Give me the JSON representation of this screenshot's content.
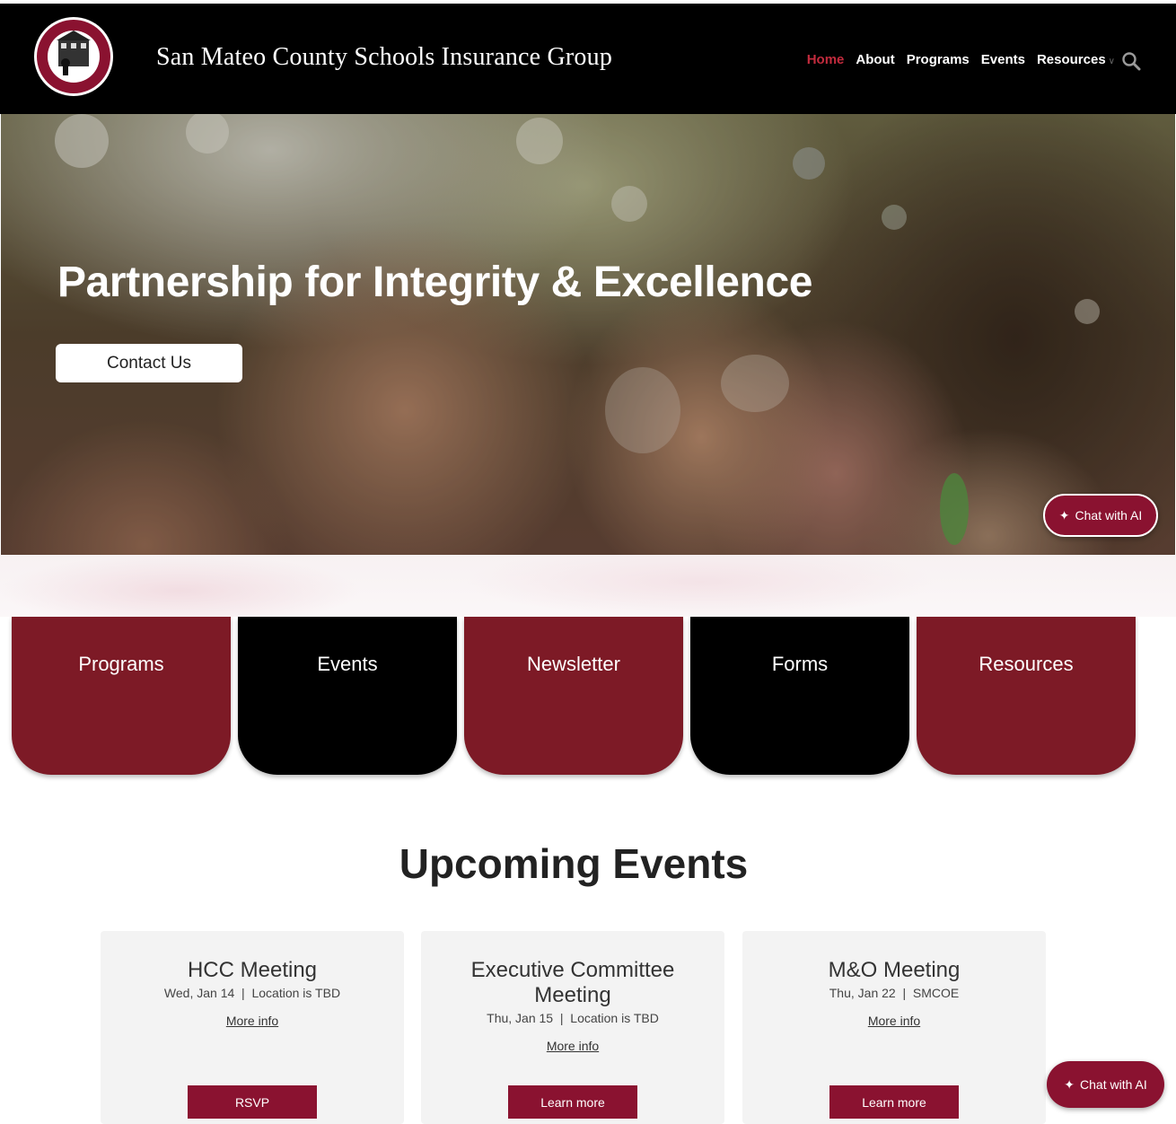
{
  "header": {
    "logo_text": "SAN MATEO COUNTY SCHOOLS INSURANCE GROUP",
    "site_title": "San Mateo County Schools Insurance Group",
    "nav": [
      {
        "label": "Home",
        "active": true
      },
      {
        "label": "About"
      },
      {
        "label": "Programs"
      },
      {
        "label": "Events"
      },
      {
        "label": "Resources",
        "has_dropdown": true
      }
    ],
    "search_icon": "search-icon"
  },
  "hero": {
    "heading": "Partnership for Integrity & Excellence",
    "cta_label": "Contact Us"
  },
  "chat": {
    "label": "Chat with AI",
    "icon": "sparkle-icon"
  },
  "tiles": [
    {
      "label": "Programs",
      "color": "#7d1a26"
    },
    {
      "label": "Events",
      "color": "#000000"
    },
    {
      "label": "Newsletter",
      "color": "#7d1a26"
    },
    {
      "label": "Forms",
      "color": "#000000"
    },
    {
      "label": "Resources",
      "color": "#7d1a26"
    }
  ],
  "events": {
    "heading": "Upcoming Events",
    "items": [
      {
        "title": "HCC Meeting",
        "date": "Wed, Jan 14",
        "location": "Location is TBD",
        "link": "More info",
        "button": "RSVP"
      },
      {
        "title": "Executive Committee Meeting",
        "date": "Thu, Jan 15",
        "location": "Location is TBD",
        "link": "More info",
        "button": "Learn more"
      },
      {
        "title": "M&O Meeting",
        "date": "Thu, Jan 22",
        "location": "SMCOE",
        "link": "More info",
        "button": "Learn more"
      }
    ]
  },
  "colors": {
    "accent": "#8a1230",
    "tile_red": "#7d1a26",
    "nav_active": "#c22b3d"
  }
}
